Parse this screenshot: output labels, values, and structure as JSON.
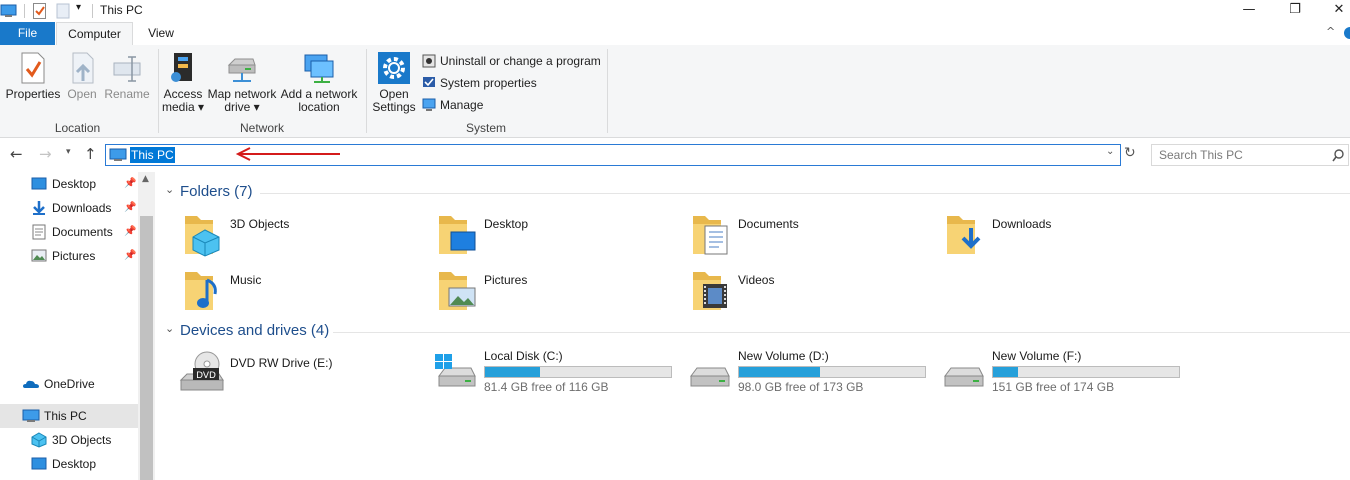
{
  "window": {
    "title": "This PC",
    "controls": {
      "minimize": "—",
      "maximize": "❐",
      "close": "✕"
    }
  },
  "tabs": [
    {
      "label": "File",
      "active_color": "#1979ca"
    },
    {
      "label": "Computer"
    },
    {
      "label": "View"
    }
  ],
  "ribbon": {
    "groups": [
      {
        "label": "Location",
        "buttons": [
          "Properties",
          "Open",
          "Rename"
        ]
      },
      {
        "label": "Network",
        "buttons": [
          "Access\nmedia ▾",
          "Map network\ndrive ▾",
          "Add a network\nlocation"
        ]
      },
      {
        "label": "System",
        "open_settings": "Open\nSettings",
        "small": [
          "Uninstall or change a program",
          "System properties",
          "Manage"
        ]
      }
    ]
  },
  "address": {
    "value": "This PC",
    "search_placeholder": "Search This PC"
  },
  "navpane": {
    "quick_access": [
      {
        "label": "Desktop",
        "icon": "desktop-icon"
      },
      {
        "label": "Downloads",
        "icon": "downloads-icon"
      },
      {
        "label": "Documents",
        "icon": "documents-icon"
      },
      {
        "label": "Pictures",
        "icon": "pictures-icon"
      }
    ],
    "onedrive": "OneDrive",
    "this_pc": "This PC",
    "this_pc_children": [
      {
        "label": "3D Objects",
        "icon": "3d-objects-icon"
      },
      {
        "label": "Desktop",
        "icon": "desktop-icon"
      }
    ]
  },
  "content": {
    "folders_header": "Folders (7)",
    "folders": [
      {
        "name": "3D Objects",
        "icon": "3d-objects-folder-icon"
      },
      {
        "name": "Desktop",
        "icon": "desktop-folder-icon"
      },
      {
        "name": "Documents",
        "icon": "documents-folder-icon"
      },
      {
        "name": "Downloads",
        "icon": "downloads-folder-icon"
      },
      {
        "name": "Music",
        "icon": "music-folder-icon"
      },
      {
        "name": "Pictures",
        "icon": "pictures-folder-icon"
      },
      {
        "name": "Videos",
        "icon": "videos-folder-icon"
      }
    ],
    "drives_header": "Devices and drives (4)",
    "drives": [
      {
        "name": "DVD RW Drive (E:)",
        "icon": "dvd-drive-icon"
      },
      {
        "name": "Local Disk (C:)",
        "free": "81.4 GB free of 116 GB",
        "used_fraction": 0.298,
        "icon": "windows-drive-icon"
      },
      {
        "name": "New Volume (D:)",
        "free": "98.0 GB free of 173 GB",
        "used_fraction": 0.434,
        "icon": "hard-drive-icon"
      },
      {
        "name": "New Volume (F:)",
        "free": "151 GB free of 174 GB",
        "used_fraction": 0.132,
        "icon": "hard-drive-icon"
      }
    ]
  },
  "colors": {
    "accent": "#1979ca",
    "bar_fill": "#26a0da",
    "header_text": "#1e4e8c",
    "annotation_arrow": "#d41b1b"
  }
}
